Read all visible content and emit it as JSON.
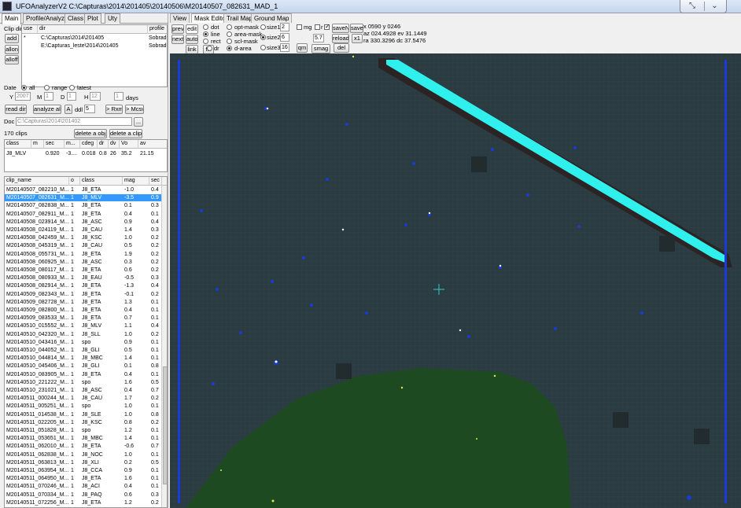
{
  "window": {
    "title": "UFOAnalyzerV2 C:\\Capturas\\2014\\201405\\20140506\\M20140507_082631_MAD_1"
  },
  "left_tabs": [
    "Main",
    "Profile/Analyze",
    "Class",
    "Plot",
    "Uty"
  ],
  "clipdir": {
    "label": "Clip dir",
    "buttons": [
      "add",
      "allon",
      "alloff"
    ],
    "headers": [
      "use",
      "dir",
      "profile"
    ],
    "rows": [
      {
        "use": "*",
        "dir": "C:\\Capturas\\2014\\201405",
        "profile": "Sobrad"
      },
      {
        "use": "",
        "dir": "E:\\Capturas_leste\\2014\\201405",
        "profile": "Sobrad"
      }
    ]
  },
  "date": {
    "label": "Date",
    "options": [
      "all",
      "range",
      "latest"
    ],
    "selected": "all",
    "y_label": "Y",
    "y_value": "2007",
    "m_label": "M",
    "m_value": "1",
    "d_label": "D",
    "d_value": "1",
    "h_label": "H",
    "h_value": "12",
    "days_value": "1",
    "days_label": "days"
  },
  "actions": {
    "read_dir": "read dir",
    "analyze_all": "analyze all",
    "a": "A",
    "ddl": "ddl",
    "ddl_value": "5",
    "rxml": "> Rxml",
    "mcsv": "> Mcsv"
  },
  "doc": {
    "label": "Doc",
    "value": "C:\\Capturas\\2014\\201402",
    "browse": "..."
  },
  "clips": {
    "count": "170 clips",
    "delete_obj": "delete a obj",
    "delete_clip": "delete a clip"
  },
  "obj_table": {
    "headers": [
      "class",
      "m",
      "sec",
      "m...",
      "cdeg",
      "dr",
      "dv",
      "Vo",
      "av"
    ],
    "row": [
      "J8_MLV",
      "",
      "0.920",
      "-3....",
      "0.018",
      "0.8",
      "26",
      "35.2",
      "21.15"
    ]
  },
  "clip_table": {
    "headers": [
      "clip_name",
      "o",
      "class",
      "mag",
      "sec"
    ],
    "selected_index": 1,
    "rows": [
      [
        "M20140507_082210_M...",
        "1",
        "J8_ETA",
        "-1.0",
        "0.4"
      ],
      [
        "M20140507_082631_M...",
        "1",
        "J8_MLV",
        "-3.5",
        "0.9"
      ],
      [
        "M20140507_082838_M...",
        "1",
        "J8_ETA",
        "0.1",
        "0.3"
      ],
      [
        "M20140507_082911_M...",
        "1",
        "J8_ETA",
        "0.4",
        "0.1"
      ],
      [
        "M20140508_023914_M...",
        "1",
        "J8_ASC",
        "0.9",
        "0.4"
      ],
      [
        "M20140508_024119_M...",
        "1",
        "J8_CAU",
        "1.4",
        "0.3"
      ],
      [
        "M20140508_042459_M...",
        "1",
        "J8_KSC",
        "1.0",
        "0.2"
      ],
      [
        "M20140508_045319_M...",
        "1",
        "J8_CAU",
        "0.5",
        "0.2"
      ],
      [
        "M20140508_055731_M...",
        "1",
        "J8_ETA",
        "1.9",
        "0.2"
      ],
      [
        "M20140508_060925_M...",
        "1",
        "J8_ASC",
        "0.3",
        "0.2"
      ],
      [
        "M20140508_080117_M...",
        "1",
        "J8_ETA",
        "0.6",
        "0.2"
      ],
      [
        "M20140508_080933_M...",
        "1",
        "J8_EAU",
        "-0.5",
        "0.3"
      ],
      [
        "M20140508_082914_M...",
        "1",
        "J8_ETA",
        "-1.3",
        "0.4"
      ],
      [
        "M20140509_082343_M...",
        "1",
        "J8_ETA",
        "-0.1",
        "0.2"
      ],
      [
        "M20140509_082728_M...",
        "1",
        "J8_ETA",
        "1.3",
        "0.1"
      ],
      [
        "M20140509_082800_M...",
        "1",
        "J8_ETA",
        "0.4",
        "0.1"
      ],
      [
        "M20140509_083533_M...",
        "1",
        "J8_ETA",
        "0.7",
        "0.1"
      ],
      [
        "M20140510_015552_M...",
        "1",
        "J8_MLV",
        "1.1",
        "0.4"
      ],
      [
        "M20140510_042320_M...",
        "1",
        "J8_SLL",
        "1.0",
        "0.2"
      ],
      [
        "M20140510_043416_M...",
        "1",
        "spo",
        "0.9",
        "0.1"
      ],
      [
        "M20140510_044052_M...",
        "1",
        "J8_GLI",
        "0.5",
        "0.1"
      ],
      [
        "M20140510_044814_M...",
        "1",
        "J8_MBC",
        "1.4",
        "0.1"
      ],
      [
        "M20140510_045406_M...",
        "1",
        "J8_GLI",
        "0.1",
        "0.8"
      ],
      [
        "M20140510_083905_M...",
        "1",
        "J8_ETA",
        "0.4",
        "0.1"
      ],
      [
        "M20140510_221222_M...",
        "1",
        "spo",
        "1.6",
        "0.5"
      ],
      [
        "M20140510_231021_M...",
        "1",
        "J8_ASC",
        "0.4",
        "0.7"
      ],
      [
        "M20140511_000244_M...",
        "1",
        "J8_CAU",
        "1.7",
        "0.2"
      ],
      [
        "M20140511_005251_M...",
        "1",
        "spo",
        "1.0",
        "0.1"
      ],
      [
        "M20140511_014538_M...",
        "1",
        "J8_SLE",
        "1.0",
        "0.8"
      ],
      [
        "M20140511_022205_M...",
        "1",
        "J8_KSC",
        "0.8",
        "0.2"
      ],
      [
        "M20140511_051828_M...",
        "1",
        "spo",
        "1.2",
        "0.1"
      ],
      [
        "M20140511_053651_M...",
        "1",
        "J8_MBC",
        "1.4",
        "0.1"
      ],
      [
        "M20140511_062010_M...",
        "1",
        "J8_ETA",
        "-0.6",
        "0.7"
      ],
      [
        "M20140511_062838_M...",
        "1",
        "J8_NOC",
        "1.0",
        "0.1"
      ],
      [
        "M20140511_063813_M...",
        "1",
        "J8_XLI",
        "0.2",
        "0.5"
      ],
      [
        "M20140511_063954_M...",
        "1",
        "J8_CCA",
        "0.9",
        "0.1"
      ],
      [
        "M20140511_064950_M...",
        "1",
        "J8_ETA",
        "1.6",
        "0.1"
      ],
      [
        "M20140511_070246_M...",
        "1",
        "J8_ACI",
        "0.4",
        "0.1"
      ],
      [
        "M20140511_070334_M...",
        "1",
        "J8_PAQ",
        "0.6",
        "0.3"
      ],
      [
        "M20140511_072256_M...",
        "1",
        "J8_ETA",
        "1.2",
        "0.2"
      ]
    ]
  },
  "right_tabs": [
    "View",
    "Mask Editor",
    "Trail Map",
    "Ground Map"
  ],
  "toolbar": {
    "prev": "prev",
    "edit": "edit",
    "next": "next",
    "auto": "auto",
    "link": "link",
    "fill": "fill",
    "mode_options": [
      "dot",
      "line",
      "rect",
      "dr"
    ],
    "mode_selected": "line",
    "mask_options": [
      "opt-mask",
      "area-mask",
      "scl-mask",
      "d-area"
    ],
    "mask_selected": "d-area",
    "size_labels": [
      "size1",
      "size2",
      "size3"
    ],
    "size_selected": "size2",
    "size_values": [
      "2",
      "6",
      "16"
    ],
    "mg": "mg",
    "r": "r",
    "pct_value": "5.7",
    "qm": "qm",
    "smag": "smag",
    "del": "del",
    "saveN": "saveN",
    "save": "save",
    "reload": "reload",
    "x1": "x1"
  },
  "info": {
    "line1": "x 0590  y 0246",
    "line2": "az 024.4928 ev 31.1449",
    "line3": "ra 330.3296 dc 37.5476"
  }
}
